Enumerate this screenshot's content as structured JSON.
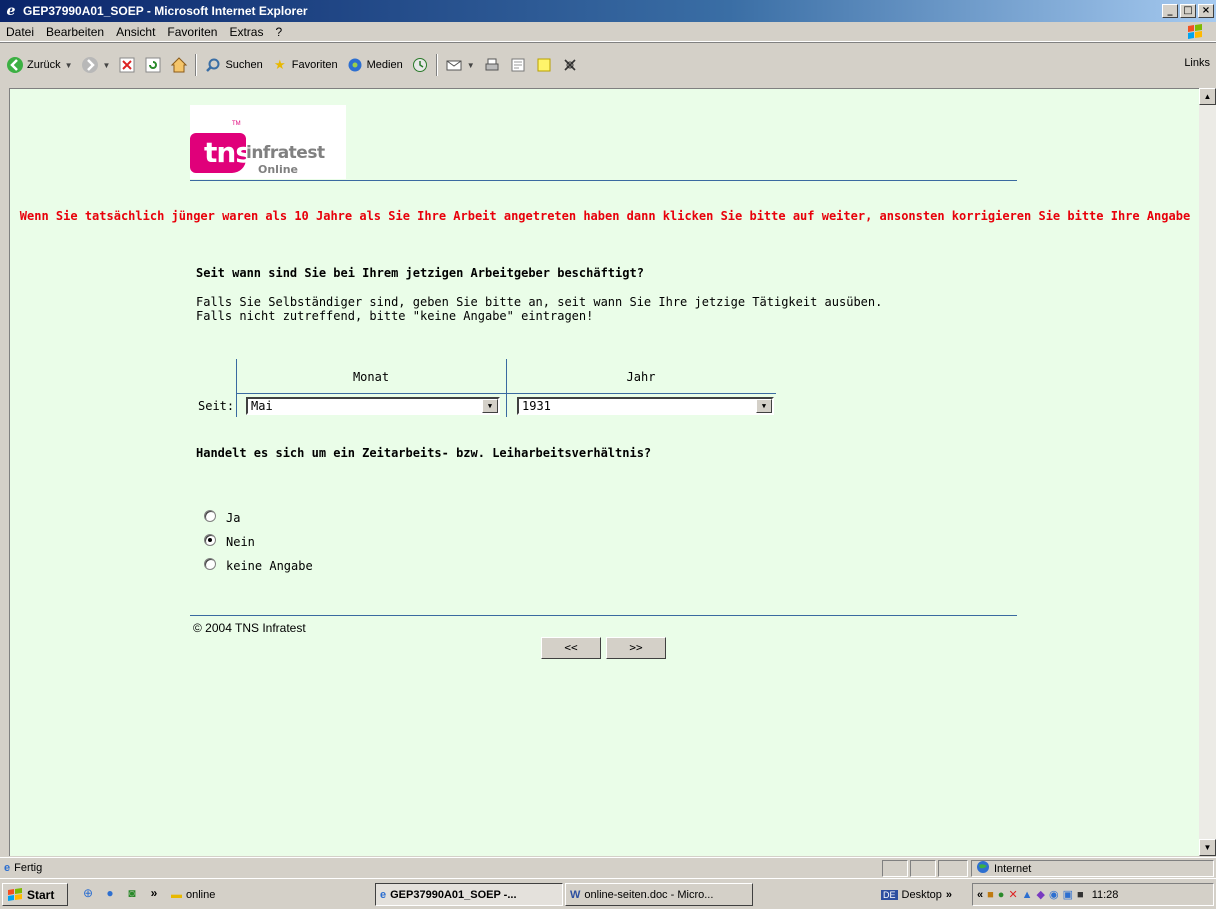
{
  "window": {
    "title": "GEP37990A01_SOEP - Microsoft Internet Explorer",
    "controls": [
      "_",
      "□",
      "×"
    ]
  },
  "menu": [
    "Datei",
    "Bearbeiten",
    "Ansicht",
    "Favoriten",
    "Extras",
    "?"
  ],
  "toolbar": {
    "back": "Zurück",
    "search": "Suchen",
    "favorites": "Favoriten",
    "media": "Medien",
    "links": "Links"
  },
  "page": {
    "logo": {
      "brand_main": "tns",
      "brand_name": "infratest",
      "brand_sub": "Online",
      "tm": "TM"
    },
    "warning": "Wenn Sie tatsächlich jünger waren als 10 Jahre als Sie Ihre Arbeit angetreten haben dann klicken Sie bitte auf weiter, ansonsten korrigieren Sie bitte Ihre Angabe",
    "question1": {
      "title": "Seit wann sind Sie bei Ihrem jetzigen Arbeitgeber beschäftigt?",
      "text_line1": "Falls Sie Selbständiger sind, geben Sie bitte an, seit wann Sie Ihre jetzige Tätigkeit ausüben.",
      "text_line2": "Falls nicht zutreffend, bitte \"keine Angabe\" eintragen!",
      "col_month": "Monat",
      "col_year": "Jahr",
      "row_label": "Seit:",
      "month_value": "Mai",
      "year_value": "1931"
    },
    "question2": {
      "title": "Handelt es sich um ein Zeitarbeits- bzw. Leiharbeitsverhältnis?",
      "options": [
        {
          "label": "Ja",
          "checked": false
        },
        {
          "label": "Nein",
          "checked": true
        },
        {
          "label": "keine Angabe",
          "checked": false
        }
      ]
    },
    "copyright": "© 2004 TNS Infratest",
    "nav": {
      "back": "<<",
      "next": ">>"
    }
  },
  "statusbar": {
    "status": "Fertig",
    "zone": "Internet"
  },
  "taskbar": {
    "start": "Start",
    "folder": "online",
    "tasks": [
      {
        "label": "GEP37990A01_SOEP -...",
        "active": true
      },
      {
        "label": "online-seiten.doc - Micro...",
        "active": false
      }
    ],
    "desktop": "Desktop",
    "lang": "DE",
    "clock": "11:28"
  },
  "colors": {
    "page_bg": "#eafde8",
    "warning": "#e8000a",
    "brand_pink": "#e0007a",
    "rule": "#3a6aa0"
  }
}
